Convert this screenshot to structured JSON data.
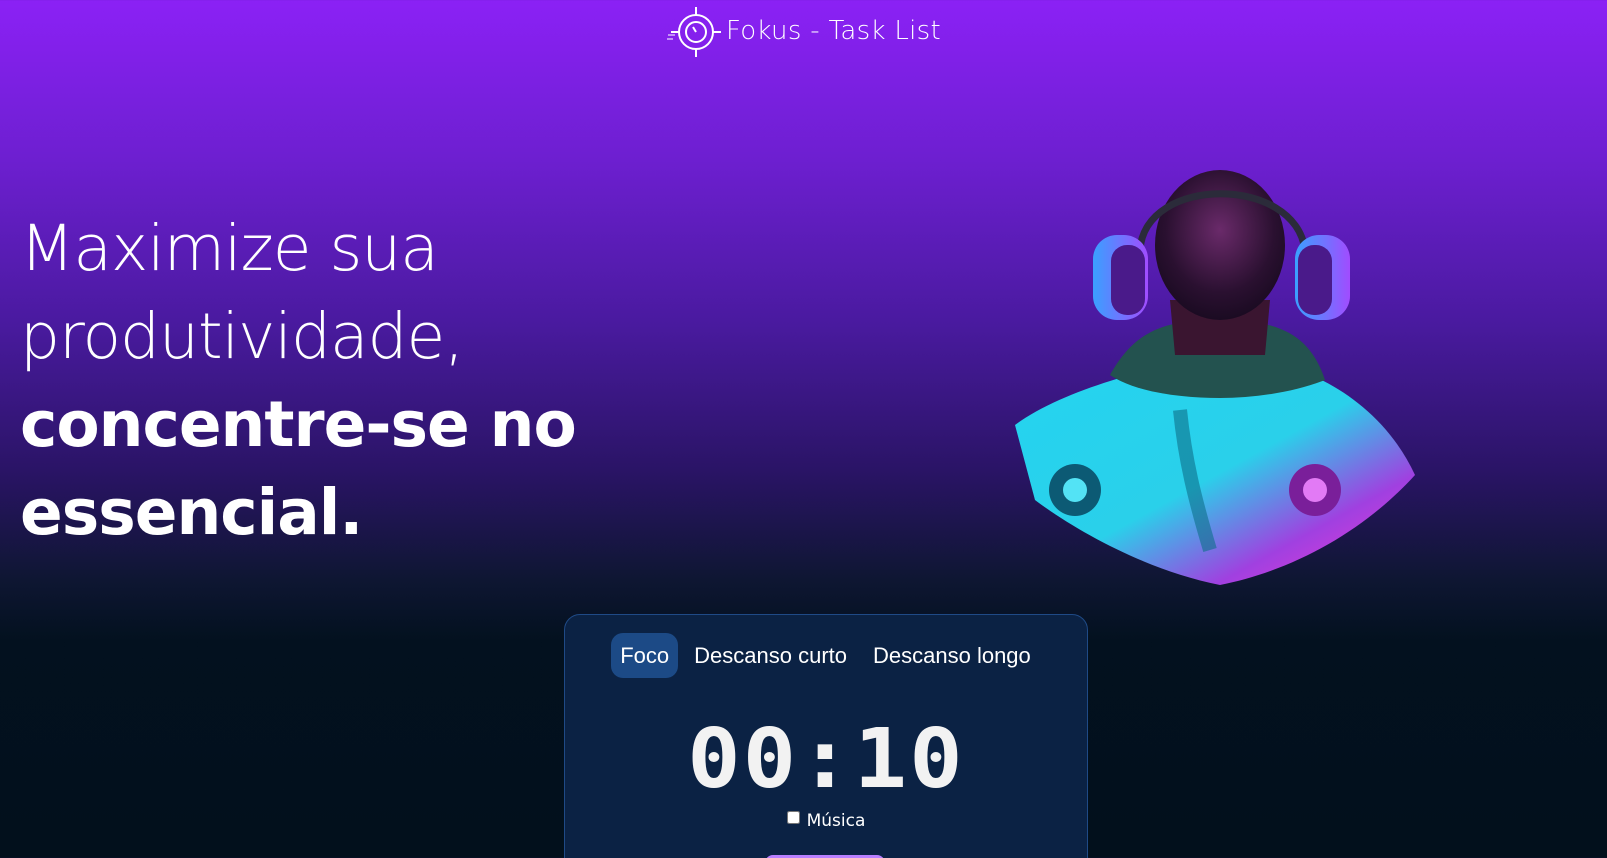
{
  "header": {
    "logo_icon": "stopwatch-target-icon",
    "title": "Fokus - Task List"
  },
  "hero": {
    "title_light": "Maximize sua produtividade, ",
    "title_bold": "concentre-se no essencial."
  },
  "timer_card": {
    "tabs": [
      {
        "label": "Foco",
        "active": true
      },
      {
        "label": "Descanso curto",
        "active": false
      },
      {
        "label": "Descanso longo",
        "active": false
      }
    ],
    "time": "00:10",
    "music_label": "Música",
    "music_checked": false
  },
  "colors": {
    "gradient_top": "#8b21f5",
    "gradient_bottom": "#02101c",
    "card_bg": "#0b2244",
    "card_border": "#1f4a86",
    "active_tab": "#1c4a86",
    "button": "#b87fff",
    "image_cyan": "#24d4f0",
    "image_magenta": "#ff38d6"
  }
}
